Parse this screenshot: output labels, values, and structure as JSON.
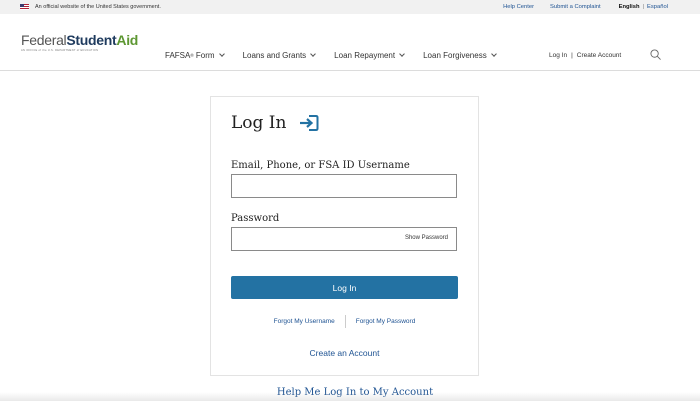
{
  "banner": {
    "official_text": "An official website of the United States government.",
    "help_center": "Help Center",
    "submit_complaint": "Submit a Complaint",
    "lang_english": "English",
    "lang_separator": "|",
    "lang_spanish": "Español"
  },
  "header": {
    "logo": {
      "federal": "Federal",
      "student": "Student",
      "aid": "Aid",
      "subtitle": "AN OFFICE of the U.S. DEPARTMENT of EDUCATION"
    },
    "nav": [
      {
        "label": "FAFSA",
        "sup": "®",
        "suffix": " Form"
      },
      {
        "label": "Loans and Grants"
      },
      {
        "label": "Loan Repayment"
      },
      {
        "label": "Loan Forgiveness"
      }
    ],
    "login_link": "Log In",
    "link_divider": "|",
    "create_account_link": "Create Account"
  },
  "login": {
    "title": "Log In",
    "username_label": "Email, Phone, or FSA ID Username",
    "username_value": "",
    "password_label": "Password",
    "password_value": "",
    "show_password": "Show Password",
    "submit_label": "Log In",
    "forgot_username": "Forgot My Username",
    "forgot_password": "Forgot My Password",
    "create_account": "Create an Account"
  },
  "help_link": "Help Me Log In to My Account",
  "colors": {
    "primary_button": "#2372a3",
    "link": "#205493",
    "logo_green": "#5d9732",
    "logo_navy": "#1f3b5e"
  }
}
